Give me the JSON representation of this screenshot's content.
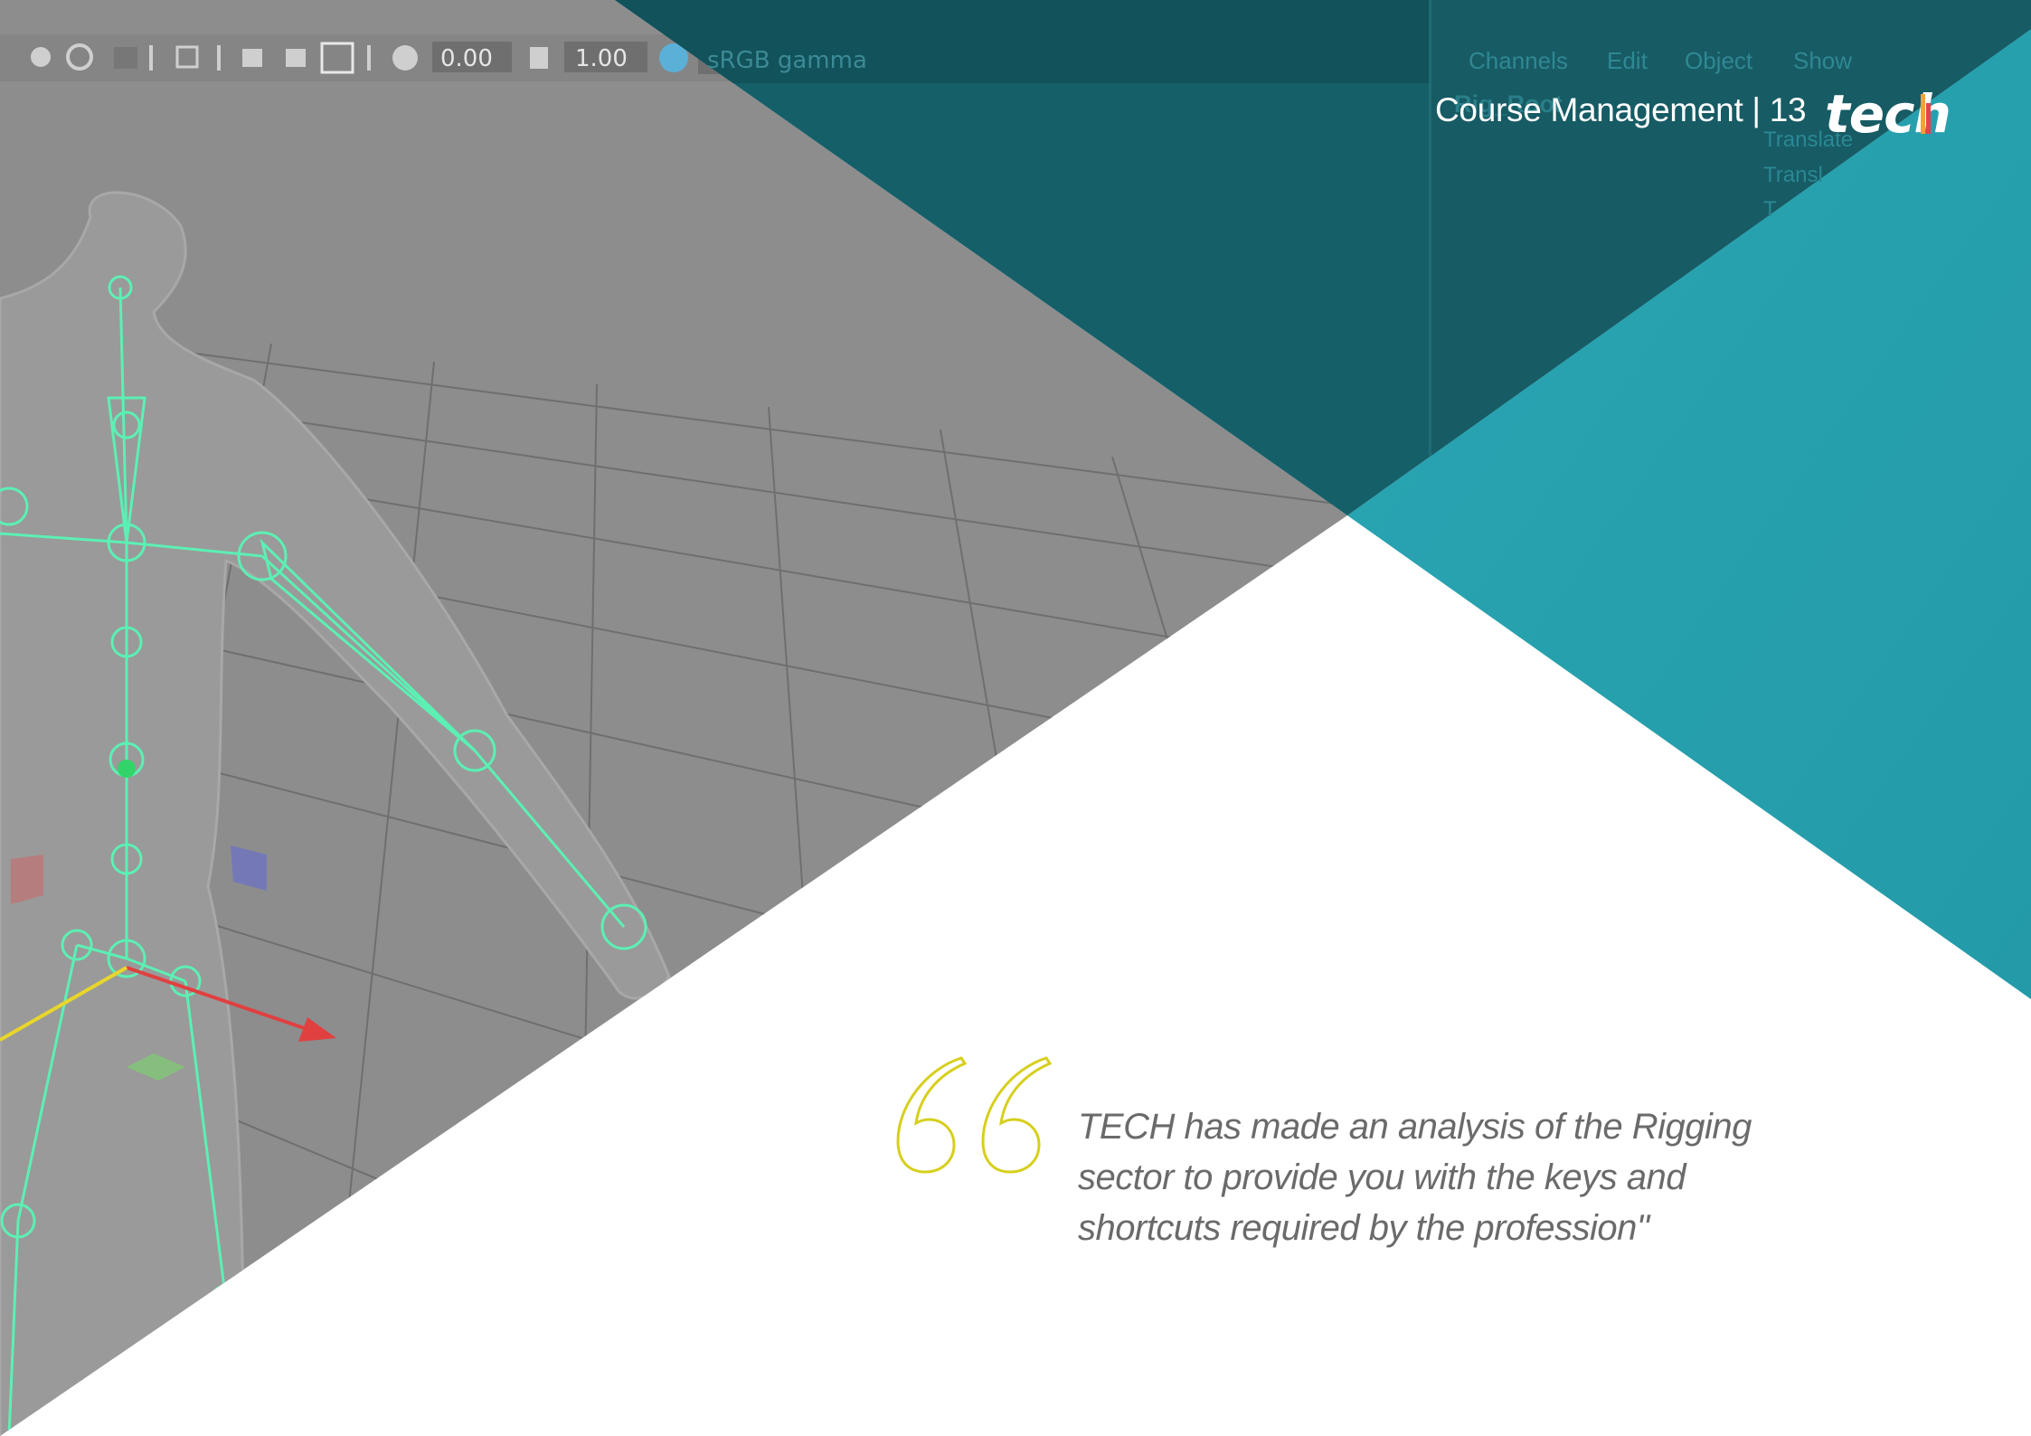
{
  "header": {
    "section": "Course Management | 13",
    "logo": "tech"
  },
  "quote": {
    "lines": [
      "TECH has made an analysis of the Rigging",
      "sector to provide you with the keys and",
      "shortcuts required by the profession\""
    ]
  },
  "viewport_toolbar": {
    "exposure_value": "0.00",
    "gamma_value": "1.00",
    "color_space": "sRGB gamma"
  },
  "channel_box": {
    "menu": [
      "Channels",
      "Edit",
      "Object",
      "Show"
    ],
    "object_name": "Rig_Root",
    "attributes": [
      "Translate",
      "Transl",
      "T"
    ]
  },
  "colors": {
    "teal_light": "#29a3b1",
    "teal_dark": "#155f69",
    "viewport_grey": "#8d8d8d",
    "skeleton_green": "#5cf0b4",
    "quote_mark": "#d6cf1c",
    "quote_text": "#6a6a6a"
  }
}
